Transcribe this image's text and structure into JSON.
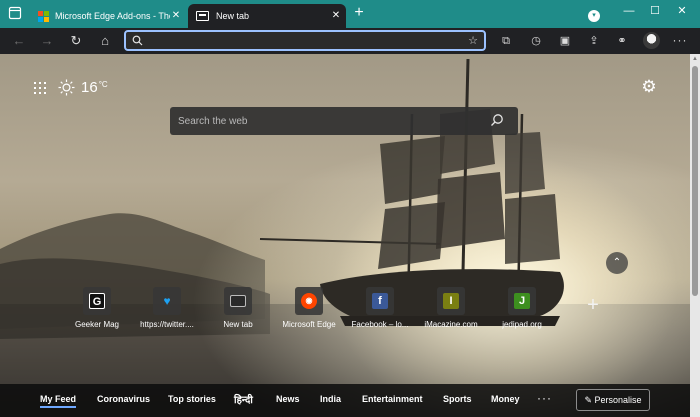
{
  "window": {
    "tabs": [
      {
        "title": "Microsoft Edge Add-ons - Themes",
        "close": "✕"
      },
      {
        "title": "New tab",
        "close": "✕"
      }
    ],
    "new_tab_symbol": "+",
    "controls": {
      "minimize": "—",
      "maximize": "☐",
      "close": "✕"
    }
  },
  "toolbar": {
    "back": "←",
    "forward": "→",
    "refresh": "↻",
    "home": "⌂",
    "address_value": "",
    "address_placeholder": "",
    "more": "···"
  },
  "newtab": {
    "weather": {
      "temp": "16",
      "unit": "°C",
      "icon": "sun-icon"
    },
    "search_placeholder": "Search the web",
    "settings_icon": "gear-icon",
    "quick_links": [
      {
        "label": "Geeker Mag",
        "letter": "G",
        "bg": "#111111"
      },
      {
        "label": "https://twitter....",
        "letter": "🐦",
        "bg": "#1da1f2"
      },
      {
        "label": "New tab",
        "letter": "",
        "bg": "#2a2a2a"
      },
      {
        "label": "Microsoft Edge",
        "letter": "●",
        "bg": "#ff4500"
      },
      {
        "label": "Facebook – lo...",
        "letter": "f",
        "bg": "#3b5998"
      },
      {
        "label": "iMacazine.com",
        "letter": "I",
        "bg": "#7a7f12"
      },
      {
        "label": "jedipad.org",
        "letter": "J",
        "bg": "#3d8f1f"
      }
    ],
    "add_link": "+",
    "collapse": "⌃"
  },
  "feed": {
    "items": [
      "My Feed",
      "Coronavirus",
      "Top stories",
      "हिन्दी",
      "News",
      "India",
      "Entertainment",
      "Sports",
      "Money"
    ],
    "more": "···",
    "personalise": "Personalise"
  },
  "colors": {
    "titlebar": "#1f8c89",
    "toolbar": "#202124",
    "address_focus": "#9cc2ff",
    "feed_active": "#6fa8ff"
  }
}
